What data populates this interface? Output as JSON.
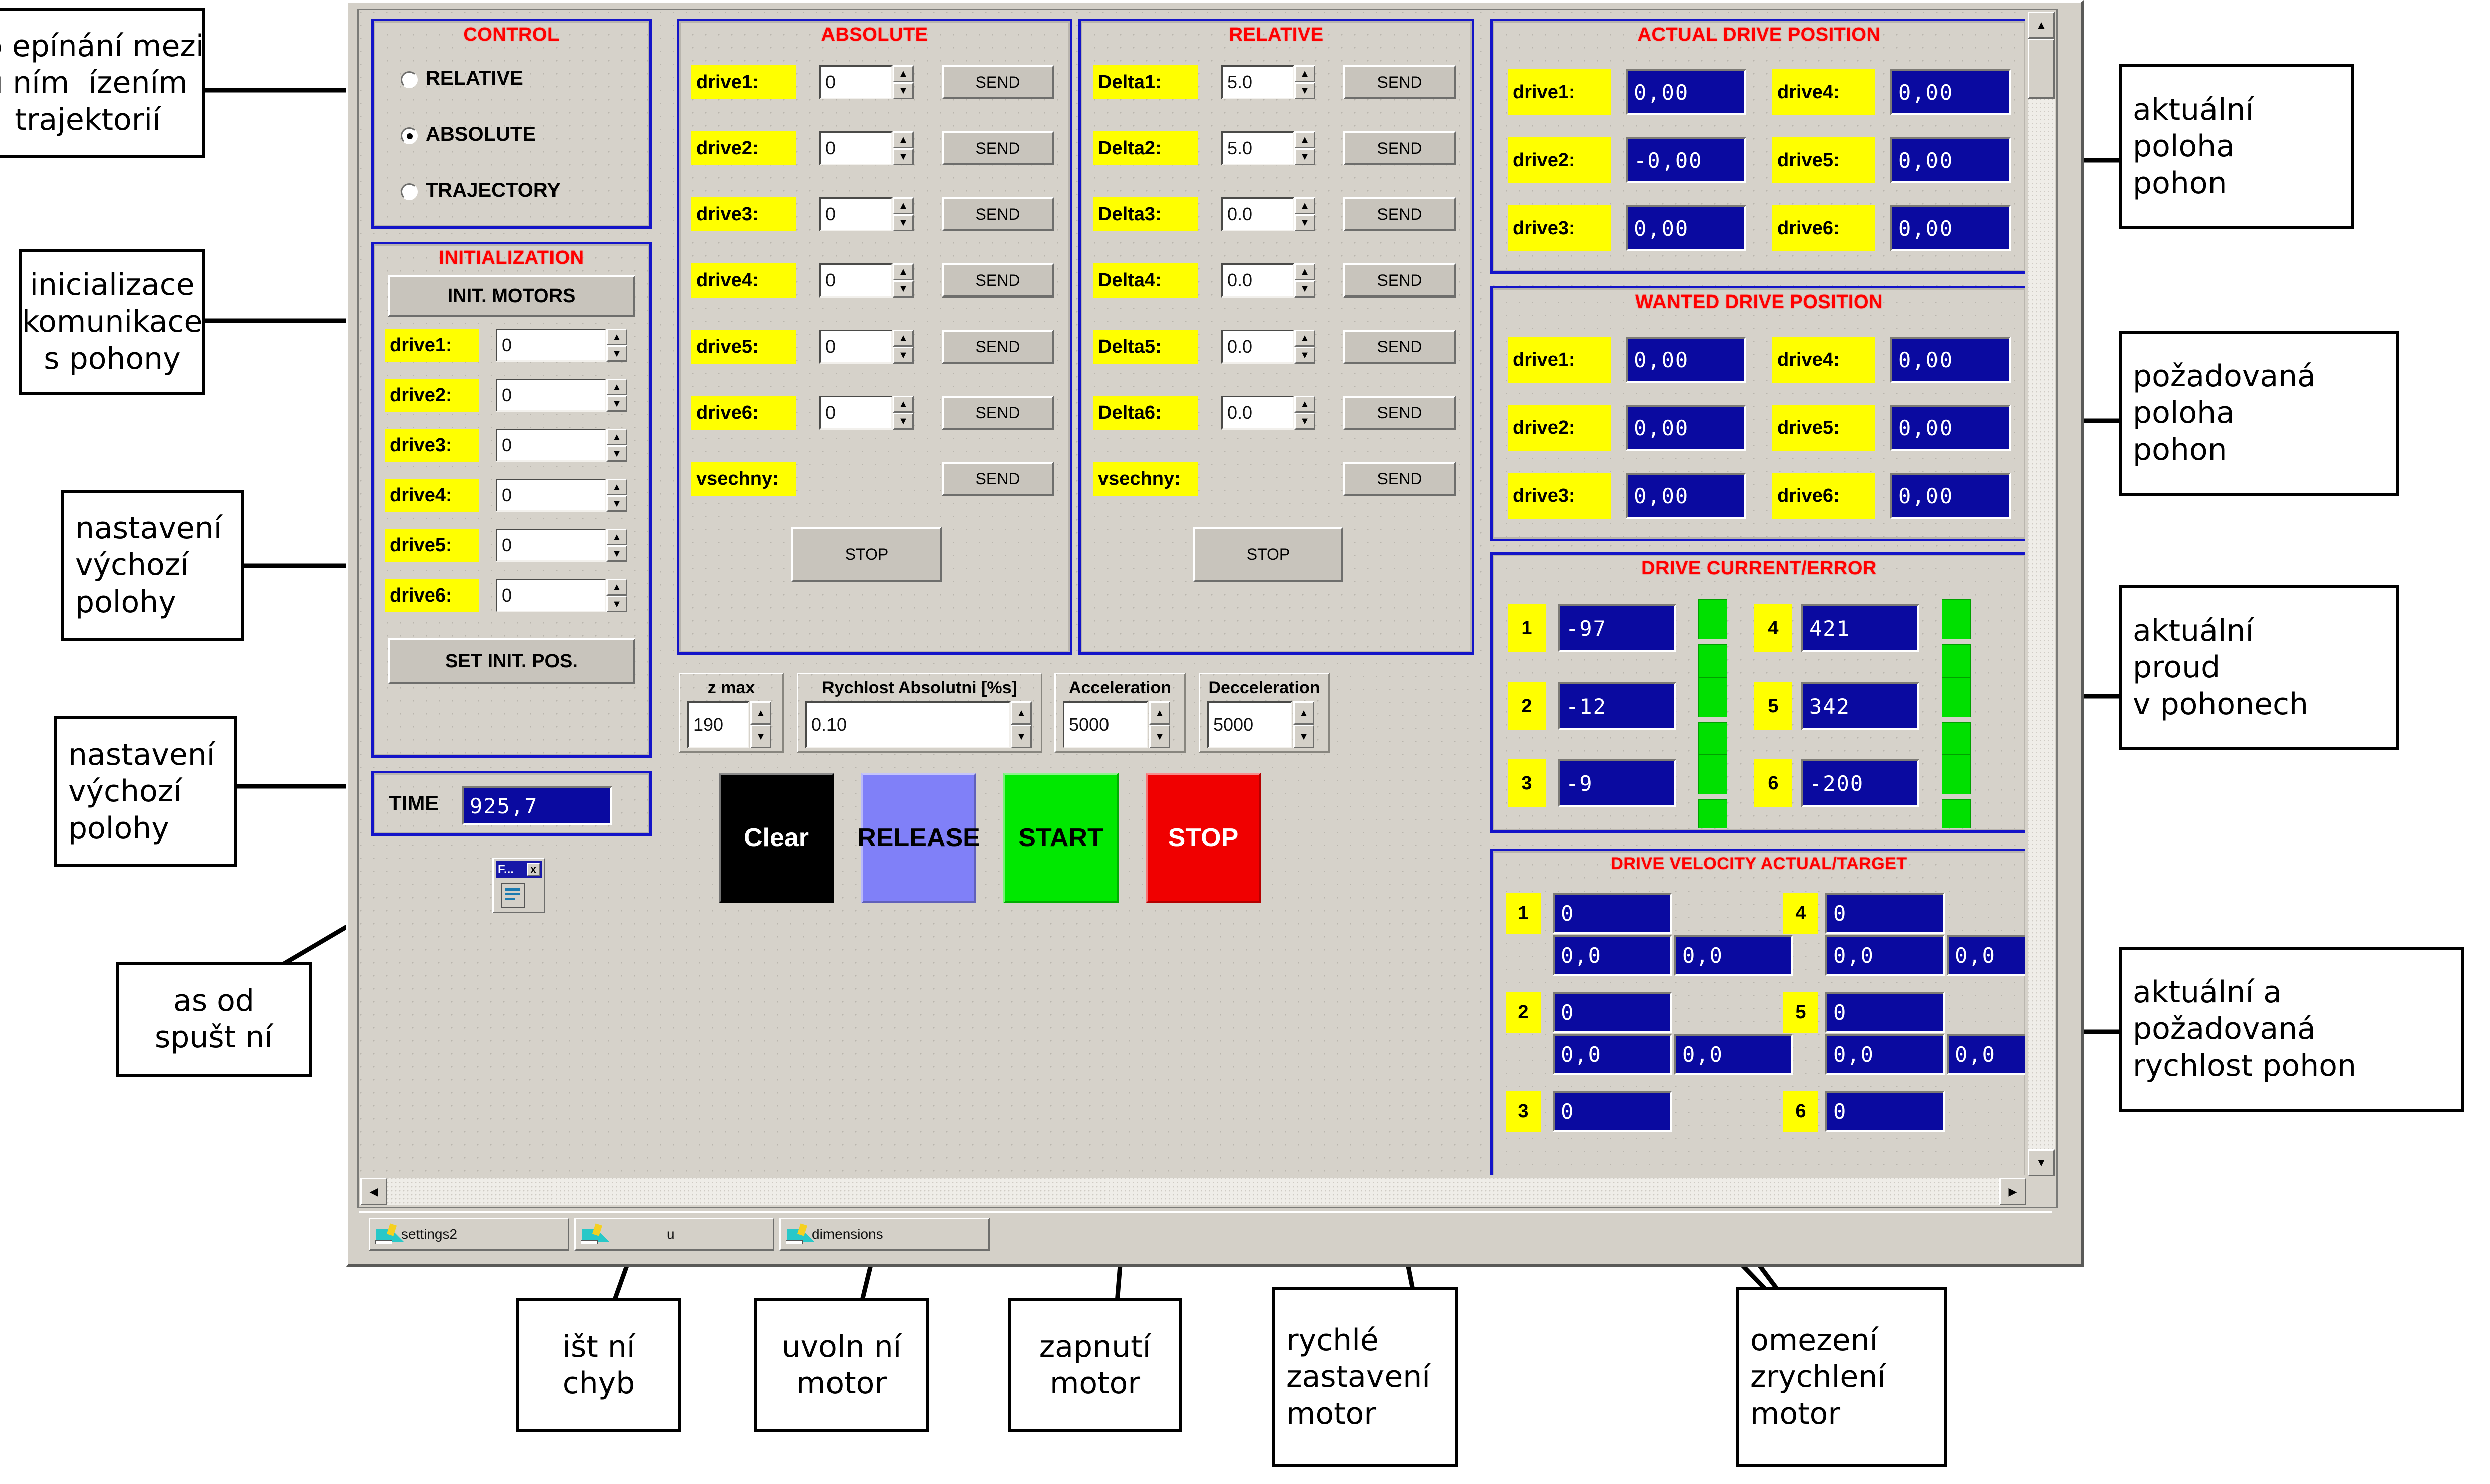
{
  "annotations": {
    "left": [
      {
        "lines": [
          "o epínání mezi",
          "u ním  ízením",
          "trajektorií"
        ]
      },
      {
        "lines": [
          "inicializace",
          "komunikace",
          "s pohony"
        ]
      },
      {
        "lines": [
          "nastavení",
          "výchozí",
          "polohy"
        ]
      },
      {
        "lines": [
          "nastavení",
          "výchozí",
          "polohy"
        ]
      },
      {
        "lines": [
          "as od",
          "spušt ní"
        ]
      }
    ],
    "right": [
      {
        "lines": [
          "aktuální",
          "poloha",
          "pohon"
        ]
      },
      {
        "lines": [
          "požadovaná",
          "poloha",
          "pohon"
        ]
      },
      {
        "lines": [
          "aktuální",
          "proud",
          "v pohonech"
        ]
      },
      {
        "lines": [
          "aktuální a",
          "požadovaná",
          "rychlost pohon"
        ]
      }
    ],
    "bottom": [
      {
        "lines": [
          "išt ní",
          "chyb"
        ]
      },
      {
        "lines": [
          "uvoln ní",
          "motor"
        ]
      },
      {
        "lines": [
          "zapnutí",
          "motor"
        ]
      },
      {
        "lines": [
          "rychlé",
          "zastavení",
          "motor"
        ]
      },
      {
        "lines": [
          "omezení",
          "zrychlení",
          "motor"
        ]
      }
    ]
  },
  "control": {
    "title": "CONTROL",
    "options": [
      {
        "label": "RELATIVE",
        "selected": false
      },
      {
        "label": "ABSOLUTE",
        "selected": true
      },
      {
        "label": "TRAJECTORY",
        "selected": false
      }
    ]
  },
  "initialization": {
    "title": "INITIALIZATION",
    "init_motors_label": "INIT. MOTORS",
    "set_init_pos_label": "SET INIT. POS.",
    "rows": [
      {
        "label": "drive1:",
        "value": "0"
      },
      {
        "label": "drive2:",
        "value": "0"
      },
      {
        "label": "drive3:",
        "value": "0"
      },
      {
        "label": "drive4:",
        "value": "0"
      },
      {
        "label": "drive5:",
        "value": "0"
      },
      {
        "label": "drive6:",
        "value": "0"
      }
    ]
  },
  "time_panel": {
    "label": "TIME",
    "value": "925,7"
  },
  "absolute": {
    "title": "ABSOLUTE",
    "send_label": "SEND",
    "stop_label": "STOP",
    "all_label": "vsechny:",
    "rows": [
      {
        "label": "drive1:",
        "value": "0"
      },
      {
        "label": "drive2:",
        "value": "0"
      },
      {
        "label": "drive3:",
        "value": "0"
      },
      {
        "label": "drive4:",
        "value": "0"
      },
      {
        "label": "drive5:",
        "value": "0"
      },
      {
        "label": "drive6:",
        "value": "0"
      }
    ]
  },
  "relative": {
    "title": "RELATIVE",
    "send_label": "SEND",
    "stop_label": "STOP",
    "all_label": "vsechny:",
    "rows": [
      {
        "label": "Delta1:",
        "value": "5.0"
      },
      {
        "label": "Delta2:",
        "value": "5.0"
      },
      {
        "label": "Delta3:",
        "value": "0.0"
      },
      {
        "label": "Delta4:",
        "value": "0.0"
      },
      {
        "label": "Delta5:",
        "value": "0.0"
      },
      {
        "label": "Delta6:",
        "value": "0.0"
      }
    ]
  },
  "actual_position": {
    "title": "ACTUAL DRIVE POSITION",
    "cells": [
      {
        "label": "drive1:",
        "value": "0,00"
      },
      {
        "label": "drive4:",
        "value": "0,00"
      },
      {
        "label": "drive2:",
        "value": "-0,00"
      },
      {
        "label": "drive5:",
        "value": "0,00"
      },
      {
        "label": "drive3:",
        "value": "0,00"
      },
      {
        "label": "drive6:",
        "value": "0,00"
      }
    ]
  },
  "wanted_position": {
    "title": "WANTED DRIVE POSITION",
    "cells": [
      {
        "label": "drive1:",
        "value": "0,00"
      },
      {
        "label": "drive4:",
        "value": "0,00"
      },
      {
        "label": "drive2:",
        "value": "0,00"
      },
      {
        "label": "drive5:",
        "value": "0,00"
      },
      {
        "label": "drive3:",
        "value": "0,00"
      },
      {
        "label": "drive6:",
        "value": "0,00"
      }
    ]
  },
  "drive_current": {
    "title": "DRIVE CURRENT/ERROR",
    "cells": [
      {
        "label": "1",
        "value": "-97"
      },
      {
        "label": "4",
        "value": "421"
      },
      {
        "label": "2",
        "value": "-12"
      },
      {
        "label": "5",
        "value": "342"
      },
      {
        "label": "3",
        "value": "-9"
      },
      {
        "label": "6",
        "value": "-200"
      }
    ],
    "led_color": "#00e000"
  },
  "drive_velocity": {
    "title": "DRIVE VELOCITY ACTUAL/TARGET",
    "groups": [
      {
        "label": "1",
        "actual": "0",
        "sub1": "0,0",
        "sub2": "0,0"
      },
      {
        "label": "4",
        "actual": "0",
        "sub1": "0,0",
        "sub2": "0,0"
      },
      {
        "label": "2",
        "actual": "0",
        "sub1": "0,0",
        "sub2": "0,0"
      },
      {
        "label": "5",
        "actual": "0",
        "sub1": "0,0",
        "sub2": "0,0"
      },
      {
        "label": "3",
        "actual": "0",
        "sub1": "",
        "sub2": ""
      },
      {
        "label": "6",
        "actual": "0",
        "sub1": "",
        "sub2": ""
      }
    ]
  },
  "params": [
    {
      "title": "z max",
      "value": "190"
    },
    {
      "title": "Rychlost Absolutni [%s]",
      "value": "0.10"
    },
    {
      "title": "Acceleration",
      "value": "5000"
    },
    {
      "title": "Decceleration",
      "value": "5000"
    }
  ],
  "action_buttons": [
    {
      "label": "Clear",
      "bg": "#000000",
      "fg": "#ffffff"
    },
    {
      "label": "RELEASE",
      "bg": "#8080f8",
      "fg": "#000000"
    },
    {
      "label": "START",
      "bg": "#00e800",
      "fg": "#000000"
    },
    {
      "label": "STOP",
      "bg": "#f00000",
      "fg": "#ffffff"
    }
  ],
  "mini_window": {
    "title": "F...",
    "close": "x"
  },
  "taskbar": {
    "items": [
      {
        "label": "settings2"
      },
      {
        "label": "u"
      },
      {
        "label": "dimensions"
      }
    ]
  }
}
